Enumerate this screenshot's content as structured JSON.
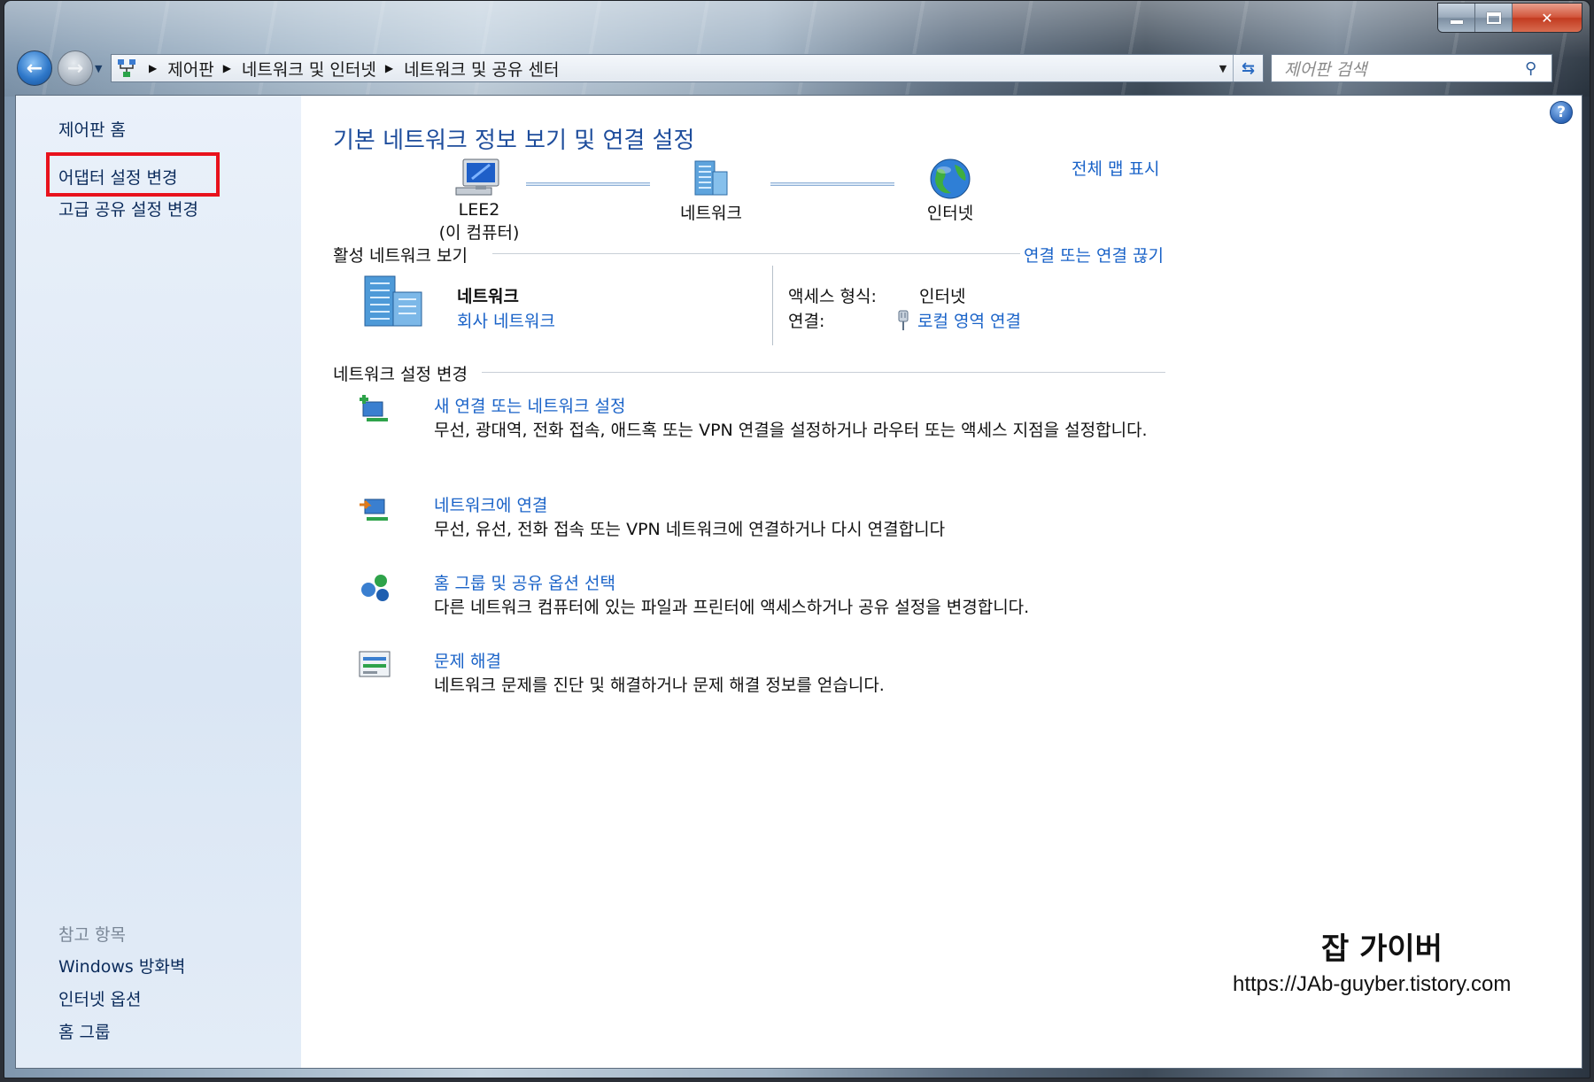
{
  "window": {
    "caption": {
      "minimize": "",
      "maximize": "",
      "close": "✕"
    }
  },
  "nav": {
    "back_glyph": "←",
    "forward_glyph": "→",
    "breadcrumb": [
      "제어판",
      "네트워크 및 인터넷",
      "네트워크 및 공유 센터"
    ],
    "search_placeholder": "제어판 검색"
  },
  "sidebar": {
    "home": "제어판 홈",
    "links": [
      "어댑터 설정 변경",
      "고급 공유 설정 변경"
    ],
    "see_also_heading": "참고 항목",
    "see_also": [
      "Windows 방화벽",
      "인터넷 옵션",
      "홈 그룹"
    ]
  },
  "main": {
    "title": "기본 네트워크 정보 보기 및 연결 설정",
    "map": {
      "computer": "LEE2",
      "computer_sub": "(이 컴퓨터)",
      "network": "네트워크",
      "internet": "인터넷",
      "full_map_link": "전체 맵 표시"
    },
    "active": {
      "heading": "활성 네트워크 보기",
      "connect_link": "연결 또는 연결 끊기",
      "network_name": "네트워크",
      "network_type": "회사 네트워크",
      "access_type_label": "액세스 형식:",
      "access_type_value": "인터넷",
      "connection_label": "연결:",
      "connection_value": "로컬 영역 연결"
    },
    "settings_heading": "네트워크 설정 변경",
    "tasks": [
      {
        "icon": "new-connection-icon",
        "title": "새 연결 또는 네트워크 설정",
        "desc": "무선, 광대역, 전화 접속, 애드혹 또는 VPN 연결을 설정하거나 라우터 또는 액세스 지점을 설정합니다."
      },
      {
        "icon": "connect-network-icon",
        "title": "네트워크에 연결",
        "desc": "무선, 유선, 전화 접속 또는 VPN 네트워크에 연결하거나 다시 연결합니다"
      },
      {
        "icon": "homegroup-icon",
        "title": "홈 그룹 및 공유 옵션 선택",
        "desc": "다른 네트워크 컴퓨터에 있는 파일과 프린터에 액세스하거나 공유 설정을 변경합니다."
      },
      {
        "icon": "troubleshoot-icon",
        "title": "문제 해결",
        "desc": "네트워크 문제를 진단 및 해결하거나 문제 해결 정보를 얻습니다."
      }
    ]
  },
  "watermark": {
    "title": "잡 가이버",
    "url": "https://JAb-guyber.tistory.com"
  },
  "colors": {
    "link": "#1a63c8",
    "title": "#1e4d9c",
    "highlight": "#e8121c",
    "sidebar_bg": "#dae6f4"
  }
}
